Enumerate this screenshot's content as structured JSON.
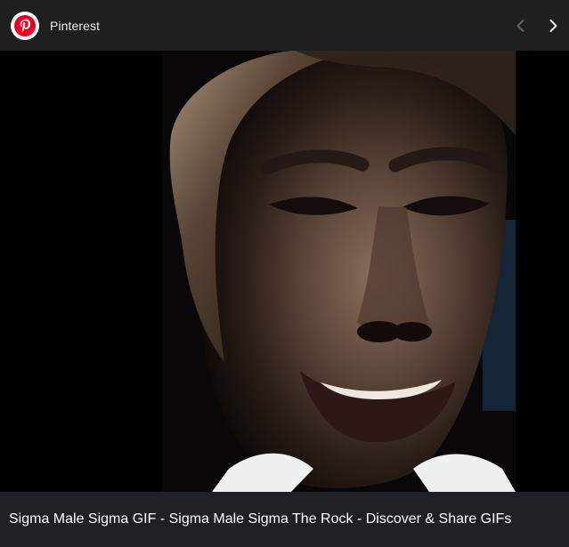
{
  "header": {
    "source_name": "Pinterest",
    "source_icon": "pinterest-logo-icon",
    "brand_color": "#e60023",
    "prev_icon": "chevron-left-icon",
    "next_icon": "chevron-right-icon"
  },
  "media": {
    "caption": "Sigma Male Sigma GIF - Sigma Male Sigma The Rock - Discover & Share GIFs"
  }
}
